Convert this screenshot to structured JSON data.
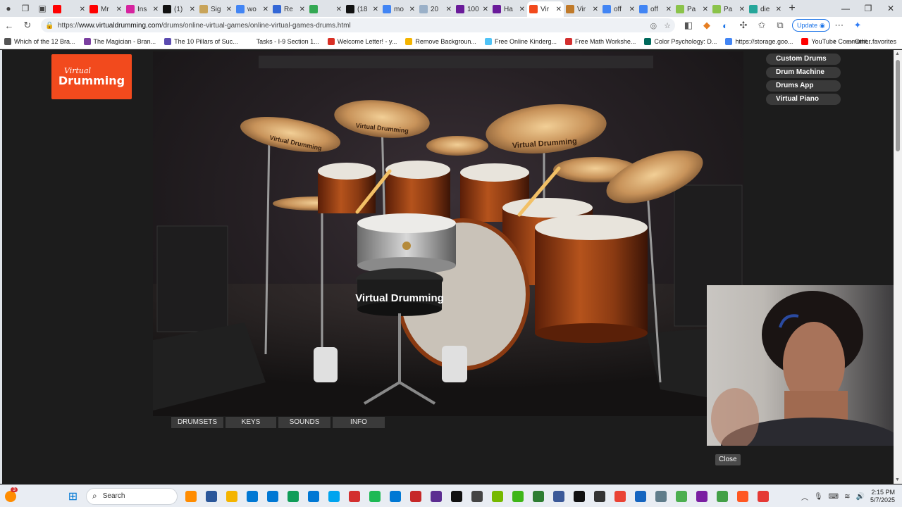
{
  "browser": {
    "tabs": [
      {
        "title": "",
        "color": "#ff0000"
      },
      {
        "title": "Mr",
        "color": "#ff0000"
      },
      {
        "title": "Ins",
        "color": "#d6249f"
      },
      {
        "title": "(1)",
        "color": "#111111"
      },
      {
        "title": "Sig",
        "color": "#c8a45a"
      },
      {
        "title": "wo",
        "color": "#4285f4"
      },
      {
        "title": "Re",
        "color": "#3367d6"
      },
      {
        "title": "",
        "color": "#34a853"
      },
      {
        "title": "(18",
        "color": "#111111"
      },
      {
        "title": "mo",
        "color": "#4285f4"
      },
      {
        "title": "20",
        "color": "#9ab0c8"
      },
      {
        "title": "100",
        "color": "#6a1b9a"
      },
      {
        "title": "Ha",
        "color": "#6a1b9a"
      },
      {
        "title": "Vir",
        "color": "#f24a1d",
        "active": true
      },
      {
        "title": "Vir",
        "color": "#c07a2a"
      },
      {
        "title": "off",
        "color": "#4285f4"
      },
      {
        "title": "off",
        "color": "#4285f4"
      },
      {
        "title": "Pa",
        "color": "#8bc34a"
      },
      {
        "title": "Pa",
        "color": "#8bc34a"
      },
      {
        "title": "die",
        "color": "#26a69a"
      }
    ],
    "url_prefix": "https://",
    "url_host": "www.virtualdrumming.com",
    "url_path": "/drums/online-virtual-games/online-virtual-games-drums.html",
    "update_label": "Update"
  },
  "bookmarks": [
    {
      "label": "Which of the 12 Bra...",
      "color": "#555555"
    },
    {
      "label": "The Magician - Bran...",
      "color": "#7b3fa0"
    },
    {
      "label": "The 10 Pillars of Suc...",
      "color": "#5b4bb0"
    },
    {
      "label": "Tasks - I-9 Section 1...",
      "color": "#ffffff"
    },
    {
      "label": "Welcome Letter! - y...",
      "color": "#d93025"
    },
    {
      "label": "Remove Backgroun...",
      "color": "#f4b400"
    },
    {
      "label": "Free Online Kinderg...",
      "color": "#4fc3f7"
    },
    {
      "label": "Free Math Workshe...",
      "color": "#d32f2f"
    },
    {
      "label": "Color Psychology: D...",
      "color": "#00695c"
    },
    {
      "label": "https://storage.goo...",
      "color": "#4285f4"
    },
    {
      "label": "YouTube Communit...",
      "color": "#ff0000"
    }
  ],
  "other_favorites": "Other favorites",
  "site": {
    "logo_line1": "Virtual",
    "logo_line2": "Drumming",
    "side_nav": [
      "Custom Drums",
      "Drum Machine",
      "Drums App",
      "Virtual Piano"
    ],
    "bottom_nav": [
      {
        "label": "DRUMSETS"
      },
      {
        "label": "KEYS"
      },
      {
        "label": "SOUNDS"
      },
      {
        "label": "INFO"
      }
    ],
    "kit_brand": "Virtual Drumming",
    "cymbal_brand": "Virtual Drumming",
    "close_label": "Close"
  },
  "taskbar": {
    "search_label": "Search",
    "notification_badge": "3",
    "apps": [
      "#ff8c00",
      "#2b579a",
      "#f4b400",
      "#0078d4",
      "#0078d4",
      "#0f9d58",
      "#0078d4",
      "#00a4ef",
      "#d32f2f",
      "#1db954",
      "#0078d4",
      "#c62828",
      "#5c2d91",
      "#111111",
      "#444444",
      "#76b900",
      "#3fb618",
      "#2e7d32",
      "#3b5998",
      "#111111",
      "#333333",
      "#ea4335",
      "#1565c0",
      "#607d8b",
      "#4caf50",
      "#7b1fa2",
      "#43a047",
      "#ff5722",
      "#e53935"
    ],
    "time": "2:15 PM",
    "date": "5/7/2025"
  }
}
